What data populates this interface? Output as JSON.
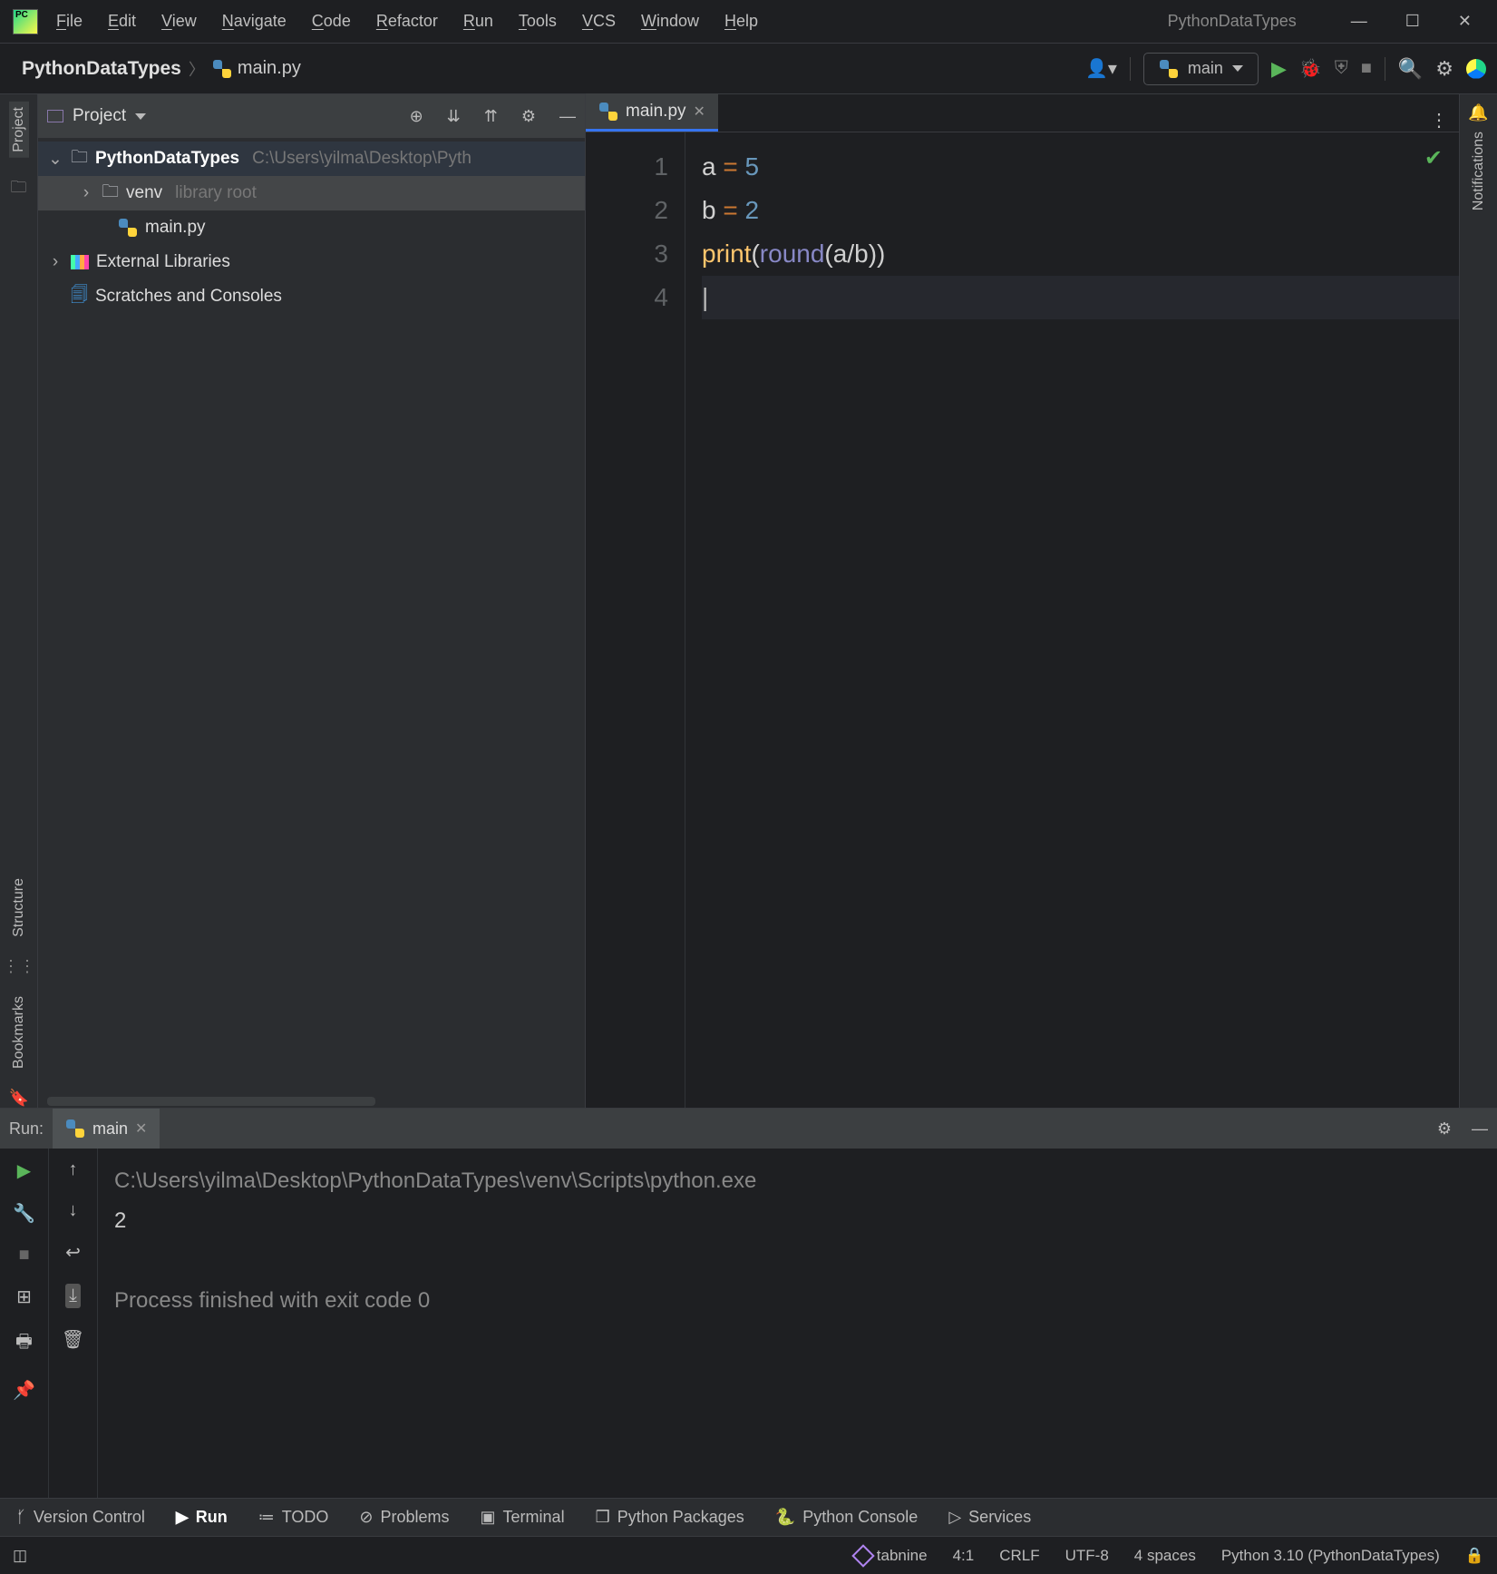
{
  "title_center": "PythonDataTypes",
  "menu": [
    "File",
    "Edit",
    "View",
    "Navigate",
    "Code",
    "Refactor",
    "Run",
    "Tools",
    "VCS",
    "Window",
    "Help"
  ],
  "breadcrumb": {
    "project": "PythonDataTypes",
    "file": "main.py"
  },
  "run_config": "main",
  "project_pane": {
    "title": "Project",
    "root_name": "PythonDataTypes",
    "root_path": "C:\\Users\\yilma\\Desktop\\Pyth",
    "venv_label": "venv",
    "venv_hint": "library root",
    "main_file": "main.py",
    "ext_lib": "External Libraries",
    "scratches": "Scratches and Consoles"
  },
  "editor": {
    "tab": "main.py",
    "lines": [
      {
        "n": "1",
        "tokens": [
          [
            "c-var",
            "a "
          ],
          [
            "c-op",
            "= "
          ],
          [
            "c-num",
            "5"
          ]
        ]
      },
      {
        "n": "2",
        "tokens": [
          [
            "c-var",
            "b "
          ],
          [
            "c-op",
            "= "
          ],
          [
            "c-num",
            "2"
          ]
        ]
      },
      {
        "n": "3",
        "tokens": [
          [
            "c-fn",
            "print"
          ],
          [
            "c-par",
            "("
          ],
          [
            "c-builtin",
            "round"
          ],
          [
            "c-par",
            "("
          ],
          [
            "c-var",
            "a"
          ],
          [
            "c-var",
            "/"
          ],
          [
            "c-var",
            "b"
          ],
          [
            "c-par",
            ")"
          ],
          [
            "c-par",
            ")"
          ]
        ]
      },
      {
        "n": "4",
        "tokens": []
      }
    ]
  },
  "run_panel": {
    "label": "Run:",
    "tab": "main",
    "cmd": "C:\\Users\\yilma\\Desktop\\PythonDataTypes\\venv\\Scripts\\python.exe",
    "output": "2",
    "exit": "Process finished with exit code 0"
  },
  "bottom_tabs": [
    "Version Control",
    "Run",
    "TODO",
    "Problems",
    "Terminal",
    "Python Packages",
    "Python Console",
    "Services"
  ],
  "left_tabs": {
    "project": "Project",
    "structure": "Structure",
    "bookmarks": "Bookmarks"
  },
  "right_tabs": {
    "notifications": "Notifications"
  },
  "status": {
    "tabnine": "tabnine",
    "pos": "4:1",
    "eol": "CRLF",
    "enc": "UTF-8",
    "indent": "4 spaces",
    "interp": "Python 3.10 (PythonDataTypes)"
  }
}
